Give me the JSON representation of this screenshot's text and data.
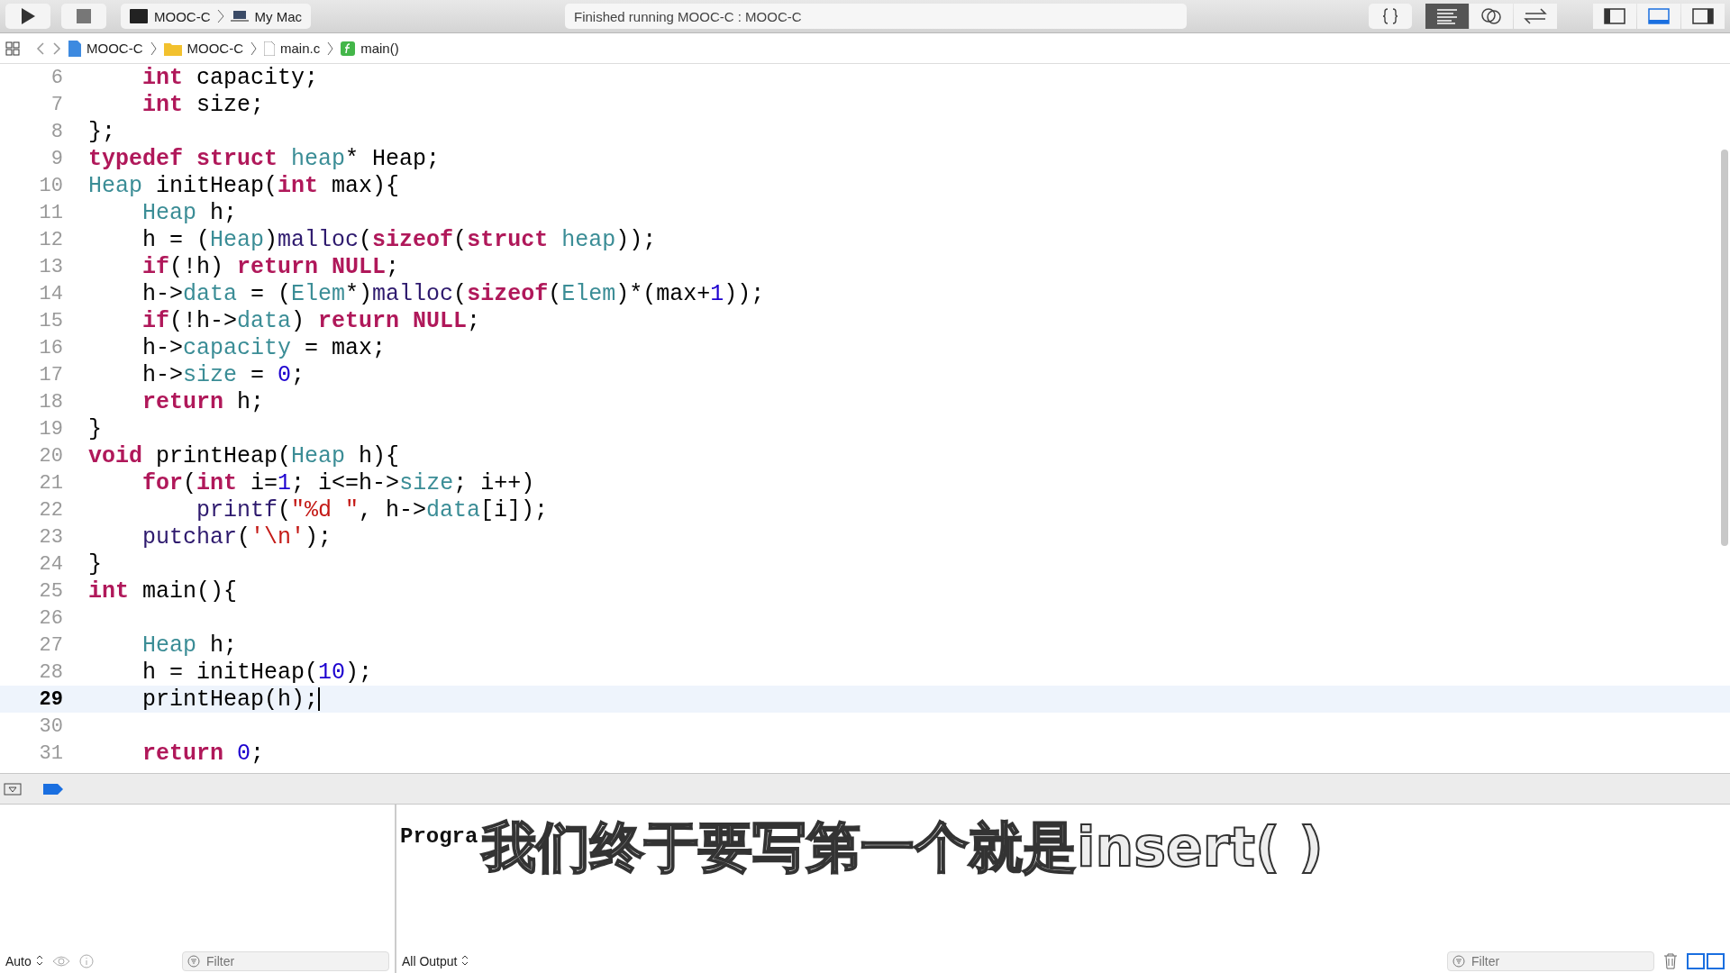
{
  "toolbar": {
    "scheme": "MOOC-C",
    "destination": "My Mac",
    "status": "Finished running MOOC-C : MOOC-C",
    "editor_modes": [
      {
        "kind": "braces",
        "selected": false
      },
      {
        "kind": "standard",
        "selected": true
      },
      {
        "kind": "assistant",
        "selected": false
      },
      {
        "kind": "version",
        "selected": false
      }
    ],
    "view_toggles": [
      {
        "kind": "left",
        "selected": false
      },
      {
        "kind": "bottom",
        "selected": true
      },
      {
        "kind": "right",
        "selected": false
      }
    ]
  },
  "jump_bar": [
    {
      "kind": "project",
      "label": "MOOC-C"
    },
    {
      "kind": "folder",
      "label": "MOOC-C"
    },
    {
      "kind": "file",
      "label": "main.c"
    },
    {
      "kind": "function",
      "label": "main()"
    }
  ],
  "editor": {
    "lines": [
      {
        "number": "6",
        "current": false,
        "tokens": [
          {
            "kind": "kw",
            "t": "    int"
          },
          {
            "kind": "pl",
            "t": " capacity;"
          }
        ]
      },
      {
        "number": "7",
        "current": false,
        "tokens": [
          {
            "kind": "kw",
            "t": "    int"
          },
          {
            "kind": "pl",
            "t": " size;"
          }
        ]
      },
      {
        "number": "8",
        "current": false,
        "tokens": [
          {
            "kind": "pl",
            "t": "};"
          }
        ]
      },
      {
        "number": "9",
        "current": false,
        "tokens": [
          {
            "kind": "kw",
            "t": "typedef struct"
          },
          {
            "kind": "ty",
            "t": " heap"
          },
          {
            "kind": "pl",
            "t": "* Heap;"
          }
        ]
      },
      {
        "number": "10",
        "current": false,
        "tokens": [
          {
            "kind": "ty",
            "t": "Heap"
          },
          {
            "kind": "pl",
            "t": " initHeap("
          },
          {
            "kind": "kw",
            "t": "int"
          },
          {
            "kind": "pl",
            "t": " max){"
          }
        ]
      },
      {
        "number": "11",
        "current": false,
        "tokens": [
          {
            "kind": "ty",
            "t": "    Heap"
          },
          {
            "kind": "pl",
            "t": " h;"
          }
        ]
      },
      {
        "number": "12",
        "current": false,
        "tokens": [
          {
            "kind": "pl",
            "t": "    h = ("
          },
          {
            "kind": "ty",
            "t": "Heap"
          },
          {
            "kind": "pl",
            "t": ")"
          },
          {
            "kind": "fn",
            "t": "malloc"
          },
          {
            "kind": "pl",
            "t": "("
          },
          {
            "kind": "kw",
            "t": "sizeof"
          },
          {
            "kind": "pl",
            "t": "("
          },
          {
            "kind": "kw",
            "t": "struct"
          },
          {
            "kind": "ty",
            "t": " heap"
          },
          {
            "kind": "pl",
            "t": "));"
          }
        ]
      },
      {
        "number": "13",
        "current": false,
        "tokens": [
          {
            "kind": "kw",
            "t": "    if"
          },
          {
            "kind": "pl",
            "t": "(!h) "
          },
          {
            "kind": "kw",
            "t": "return NULL"
          },
          {
            "kind": "pl",
            "t": ";"
          }
        ]
      },
      {
        "number": "14",
        "current": false,
        "tokens": [
          {
            "kind": "pl",
            "t": "    h->"
          },
          {
            "kind": "ty",
            "t": "data"
          },
          {
            "kind": "pl",
            "t": " = ("
          },
          {
            "kind": "ty",
            "t": "Elem"
          },
          {
            "kind": "pl",
            "t": "*)"
          },
          {
            "kind": "fn",
            "t": "malloc"
          },
          {
            "kind": "pl",
            "t": "("
          },
          {
            "kind": "kw",
            "t": "sizeof"
          },
          {
            "kind": "pl",
            "t": "("
          },
          {
            "kind": "ty",
            "t": "Elem"
          },
          {
            "kind": "pl",
            "t": ")*(max+"
          },
          {
            "kind": "num",
            "t": "1"
          },
          {
            "kind": "pl",
            "t": "));"
          }
        ]
      },
      {
        "number": "15",
        "current": false,
        "tokens": [
          {
            "kind": "kw",
            "t": "    if"
          },
          {
            "kind": "pl",
            "t": "(!h->"
          },
          {
            "kind": "ty",
            "t": "data"
          },
          {
            "kind": "pl",
            "t": ") "
          },
          {
            "kind": "kw",
            "t": "return NULL"
          },
          {
            "kind": "pl",
            "t": ";"
          }
        ]
      },
      {
        "number": "16",
        "current": false,
        "tokens": [
          {
            "kind": "pl",
            "t": "    h->"
          },
          {
            "kind": "ty",
            "t": "capacity"
          },
          {
            "kind": "pl",
            "t": " = max;"
          }
        ]
      },
      {
        "number": "17",
        "current": false,
        "tokens": [
          {
            "kind": "pl",
            "t": "    h->"
          },
          {
            "kind": "ty",
            "t": "size"
          },
          {
            "kind": "pl",
            "t": " = "
          },
          {
            "kind": "num",
            "t": "0"
          },
          {
            "kind": "pl",
            "t": ";"
          }
        ]
      },
      {
        "number": "18",
        "current": false,
        "tokens": [
          {
            "kind": "kw",
            "t": "    return"
          },
          {
            "kind": "pl",
            "t": " h;"
          }
        ]
      },
      {
        "number": "19",
        "current": false,
        "tokens": [
          {
            "kind": "pl",
            "t": "}"
          }
        ]
      },
      {
        "number": "20",
        "current": false,
        "tokens": [
          {
            "kind": "kw",
            "t": "void"
          },
          {
            "kind": "pl",
            "t": " printHeap("
          },
          {
            "kind": "ty",
            "t": "Heap"
          },
          {
            "kind": "pl",
            "t": " h){"
          }
        ]
      },
      {
        "number": "21",
        "current": false,
        "tokens": [
          {
            "kind": "kw",
            "t": "    for"
          },
          {
            "kind": "pl",
            "t": "("
          },
          {
            "kind": "kw",
            "t": "int"
          },
          {
            "kind": "pl",
            "t": " i="
          },
          {
            "kind": "num",
            "t": "1"
          },
          {
            "kind": "pl",
            "t": "; i<=h->"
          },
          {
            "kind": "ty",
            "t": "size"
          },
          {
            "kind": "pl",
            "t": "; i++)"
          }
        ]
      },
      {
        "number": "22",
        "current": false,
        "tokens": [
          {
            "kind": "fn",
            "t": "        printf"
          },
          {
            "kind": "pl",
            "t": "("
          },
          {
            "kind": "str",
            "t": "\"%d \""
          },
          {
            "kind": "pl",
            "t": ", h->"
          },
          {
            "kind": "ty",
            "t": "data"
          },
          {
            "kind": "pl",
            "t": "[i]);"
          }
        ]
      },
      {
        "number": "23",
        "current": false,
        "tokens": [
          {
            "kind": "fn",
            "t": "    putchar"
          },
          {
            "kind": "pl",
            "t": "("
          },
          {
            "kind": "str",
            "t": "'\\n'"
          },
          {
            "kind": "pl",
            "t": ");"
          }
        ]
      },
      {
        "number": "24",
        "current": false,
        "tokens": [
          {
            "kind": "pl",
            "t": "}"
          }
        ]
      },
      {
        "number": "25",
        "current": false,
        "tokens": [
          {
            "kind": "kw",
            "t": "int"
          },
          {
            "kind": "pl",
            "t": " main(){"
          }
        ]
      },
      {
        "number": "26",
        "current": false
      },
      {
        "number": "27",
        "current": false,
        "tokens": [
          {
            "kind": "ty",
            "t": "    Heap"
          },
          {
            "kind": "pl",
            "t": " h;"
          }
        ]
      },
      {
        "number": "28",
        "current": false,
        "tokens": [
          {
            "kind": "pl",
            "t": "    h = initHeap("
          },
          {
            "kind": "num",
            "t": "10"
          },
          {
            "kind": "pl",
            "t": ");"
          }
        ]
      },
      {
        "number": "29",
        "current": true,
        "tokens": [
          {
            "kind": "pl",
            "t": "    printHeap(h);"
          }
        ]
      },
      {
        "number": "30",
        "current": false
      },
      {
        "number": "31",
        "current": false,
        "tokens": [
          {
            "kind": "kw",
            "t": "    return"
          },
          {
            "kind": "num",
            "t": " 0"
          },
          {
            "kind": "pl",
            "t": ";"
          }
        ]
      }
    ]
  },
  "variables_pane": {
    "scope": "Auto",
    "filter": {
      "placeholder": "Filter"
    }
  },
  "console": {
    "output": "Progra",
    "mode": "All Output",
    "filter": {
      "placeholder": "Filter"
    }
  },
  "subtitle": "我们终于要写第一个就是insert( )"
}
